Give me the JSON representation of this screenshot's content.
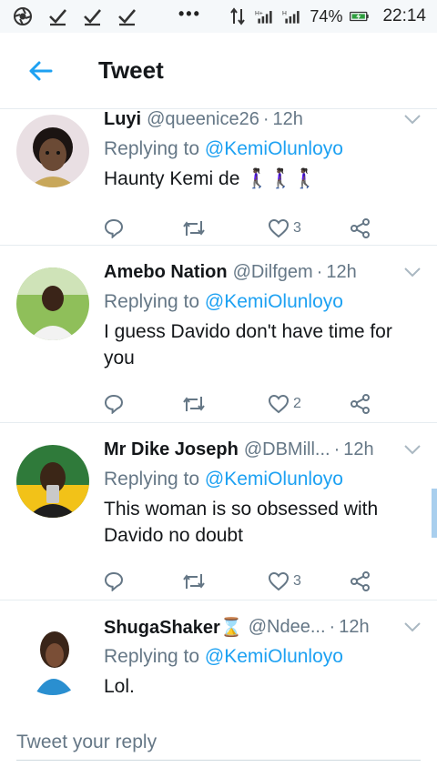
{
  "status_bar": {
    "battery": "74%",
    "time": "22:14",
    "dots": "•••",
    "icons": [
      "aperture-icon",
      "check-icon",
      "check-icon",
      "check-icon",
      "data-arrows-icon",
      "signal-icon",
      "signal-icon",
      "battery-charging-icon"
    ]
  },
  "header": {
    "title": "Tweet",
    "back_icon": "arrow-left-icon"
  },
  "colors": {
    "accent": "#1da1f2",
    "secondary_text": "#657786",
    "primary_text": "#14171a",
    "divider": "#e6ecf0"
  },
  "tweets": [
    {
      "name": "Luyi",
      "handle": "@queenice26",
      "time": "12h",
      "replying_prefix": "Replying to",
      "replying_to": "@KemiOlunloyo",
      "text": "Haunty Kemi de 🚶🏿‍♀️🚶🏿‍♀️🚶🏿‍♀️",
      "likes": "3"
    },
    {
      "name": "Amebo Nation",
      "handle": "@Dilfgem",
      "time": "12h",
      "replying_prefix": "Replying to",
      "replying_to": "@KemiOlunloyo",
      "text": "I guess Davido don't have time for you",
      "likes": "2"
    },
    {
      "name": "Mr Dike Joseph",
      "handle": "@DBMill...",
      "time": "12h",
      "replying_prefix": "Replying to",
      "replying_to": "@KemiOlunloyo",
      "text": "This woman is so obsessed with Davido no doubt",
      "likes": "3"
    },
    {
      "name": "ShugaShaker⌛",
      "handle": "@Ndee...",
      "time": "12h",
      "replying_prefix": "Replying to",
      "replying_to": "@KemiOlunloyo",
      "text": "Lol.",
      "likes": ""
    }
  ],
  "compose": {
    "placeholder": "Tweet your reply"
  }
}
